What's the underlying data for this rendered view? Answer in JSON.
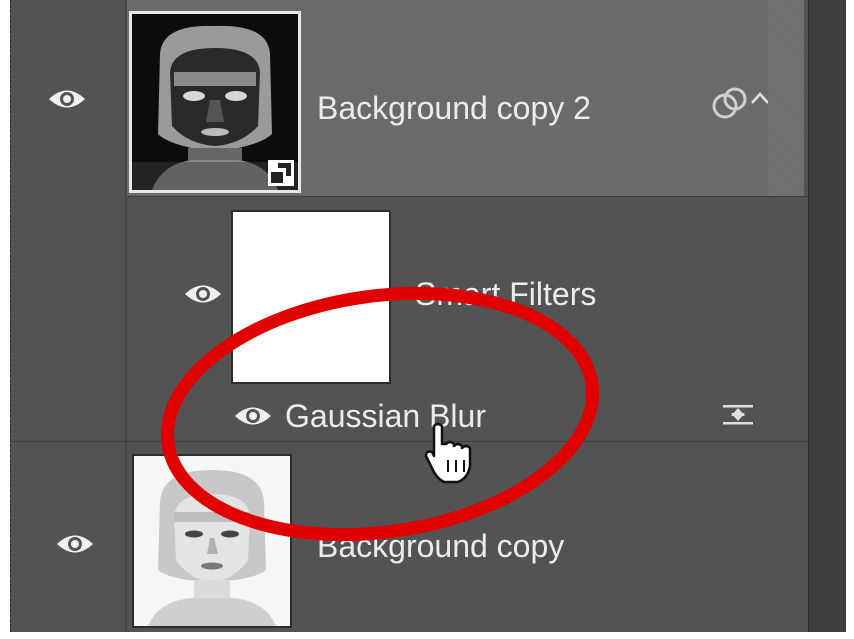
{
  "layers_panel": {
    "layers": [
      {
        "name": "Background copy 2",
        "visible": true,
        "selected": true,
        "smart_object": true
      },
      {
        "name": "Smart Filters",
        "visible": true,
        "is_filter_group": true
      },
      {
        "name": "Gaussian Blur",
        "visible": true,
        "is_filter": true
      },
      {
        "name": "Background copy",
        "visible": true
      }
    ]
  },
  "annotation": {
    "shape": "ellipse",
    "color": "#e00000"
  },
  "colors": {
    "panel_bg": "#535353",
    "selected_row": "#6a6a6a",
    "text": "#ececec",
    "annotation_red": "#e00000"
  }
}
